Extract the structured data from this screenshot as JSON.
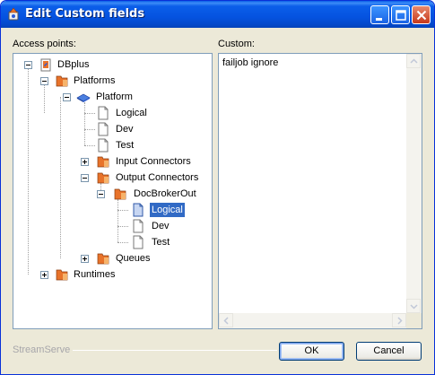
{
  "window": {
    "title": "Edit Custom fields"
  },
  "labels": {
    "access_points": "Access points:",
    "custom": "Custom:"
  },
  "tree": [
    {
      "id": "dbplus",
      "label": "DBplus"
    },
    {
      "id": "platforms",
      "label": "Platforms"
    },
    {
      "id": "platform",
      "label": "Platform"
    },
    {
      "id": "logical1",
      "label": "Logical"
    },
    {
      "id": "dev1",
      "label": "Dev"
    },
    {
      "id": "test1",
      "label": "Test"
    },
    {
      "id": "input_connectors",
      "label": "Input Connectors"
    },
    {
      "id": "output_connectors",
      "label": "Output Connectors"
    },
    {
      "id": "docbrokerout",
      "label": "DocBrokerOut"
    },
    {
      "id": "logical2",
      "label": "Logical",
      "selected": true
    },
    {
      "id": "dev2",
      "label": "Dev"
    },
    {
      "id": "test2",
      "label": "Test"
    },
    {
      "id": "queues",
      "label": "Queues"
    },
    {
      "id": "runtimes",
      "label": "Runtimes"
    }
  ],
  "custom": {
    "text": "failjob ignore"
  },
  "footer": {
    "brand": "StreamServe"
  },
  "buttons": {
    "ok": "OK",
    "cancel": "Cancel"
  },
  "colors": {
    "title_bar": "#0553e0",
    "selection": "#316ac5",
    "folder": "#e8732a"
  }
}
